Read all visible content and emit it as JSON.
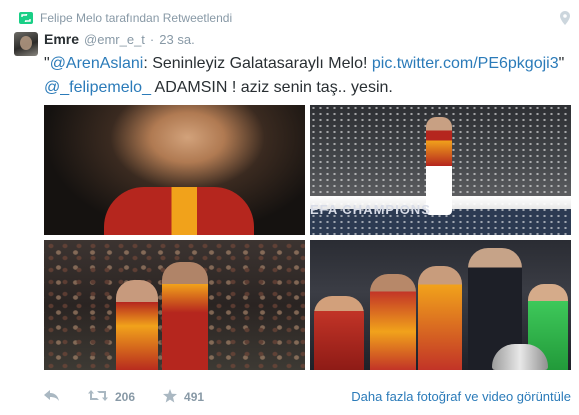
{
  "retweet_context": {
    "text": "Felipe Melo tarafından Retweetlendi"
  },
  "author": {
    "fullname": "Emre",
    "handle": "@emr_e_t",
    "separator": "·",
    "time": "23 sa."
  },
  "tweet": {
    "quote_open": "\"",
    "mention1": "@ArenAslani",
    "text1": ": Seninleyiz Galatasaraylı Melo! ",
    "link": "pic.twitter.com/PE6pkgoji3",
    "quote_close": "\"",
    "mention2": "@_felipemelo_",
    "text2": " ADAMSIN ! aziz senin taş.. yesin."
  },
  "photos": {
    "banner_text": "EFA CHAMPIONS"
  },
  "actions": {
    "retweet_count": "206",
    "favorite_count": "491",
    "more_link": "Daha fazla fotoğraf ve video görüntüle"
  },
  "colors": {
    "link": "#2b7bb9",
    "muted": "#8899a6",
    "retweet_green": "#19cf86"
  },
  "icons": [
    "retweet-icon",
    "location-pin-icon",
    "reply-icon",
    "star-icon"
  ]
}
